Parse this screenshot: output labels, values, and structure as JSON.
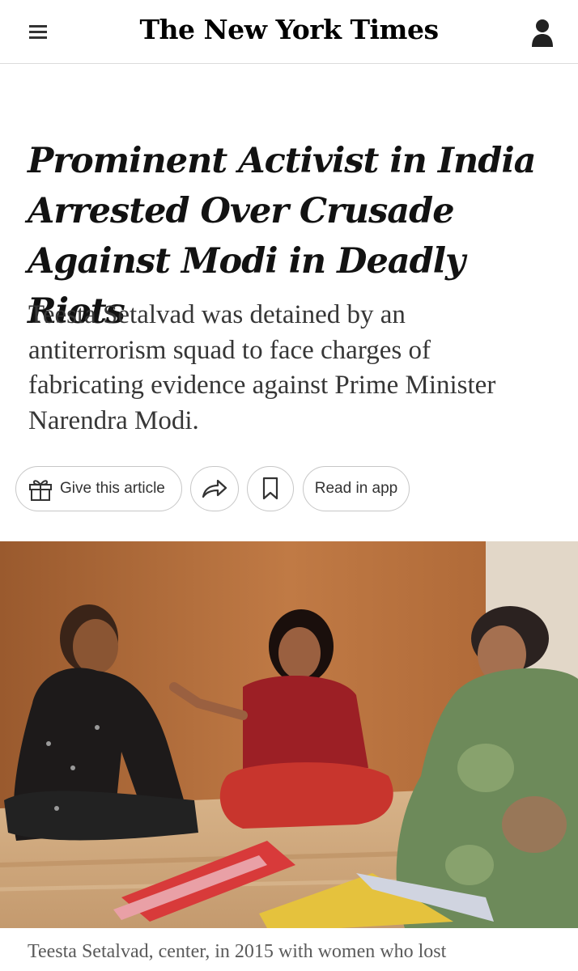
{
  "masthead": {
    "logo_text": "The New York Times",
    "menu_icon": "hamburger-menu-icon",
    "account_icon": "user-account-icon"
  },
  "article": {
    "headline": "Prominent Activist in India Arrested Over Crusade Against Modi in Deadly Riots",
    "summary": "Teesta Setalvad was detained by an antiterrorism squad to face charges of fabricating evidence against Prime Minister Narendra Modi.",
    "actions": {
      "gift_label": "Give this article",
      "gift_icon": "gift-icon",
      "share_icon": "share-arrow-icon",
      "save_icon": "bookmark-icon",
      "read_in_app_label": "Read in app"
    },
    "photo_caption": "Teesta Setalvad, center, in 2015 with women who lost"
  },
  "colors": {
    "text": "#121212",
    "summary_text": "#363636",
    "caption_text": "#5a5a5a",
    "border": "#c7c7c7",
    "photo_wall": "#b46f3c"
  }
}
